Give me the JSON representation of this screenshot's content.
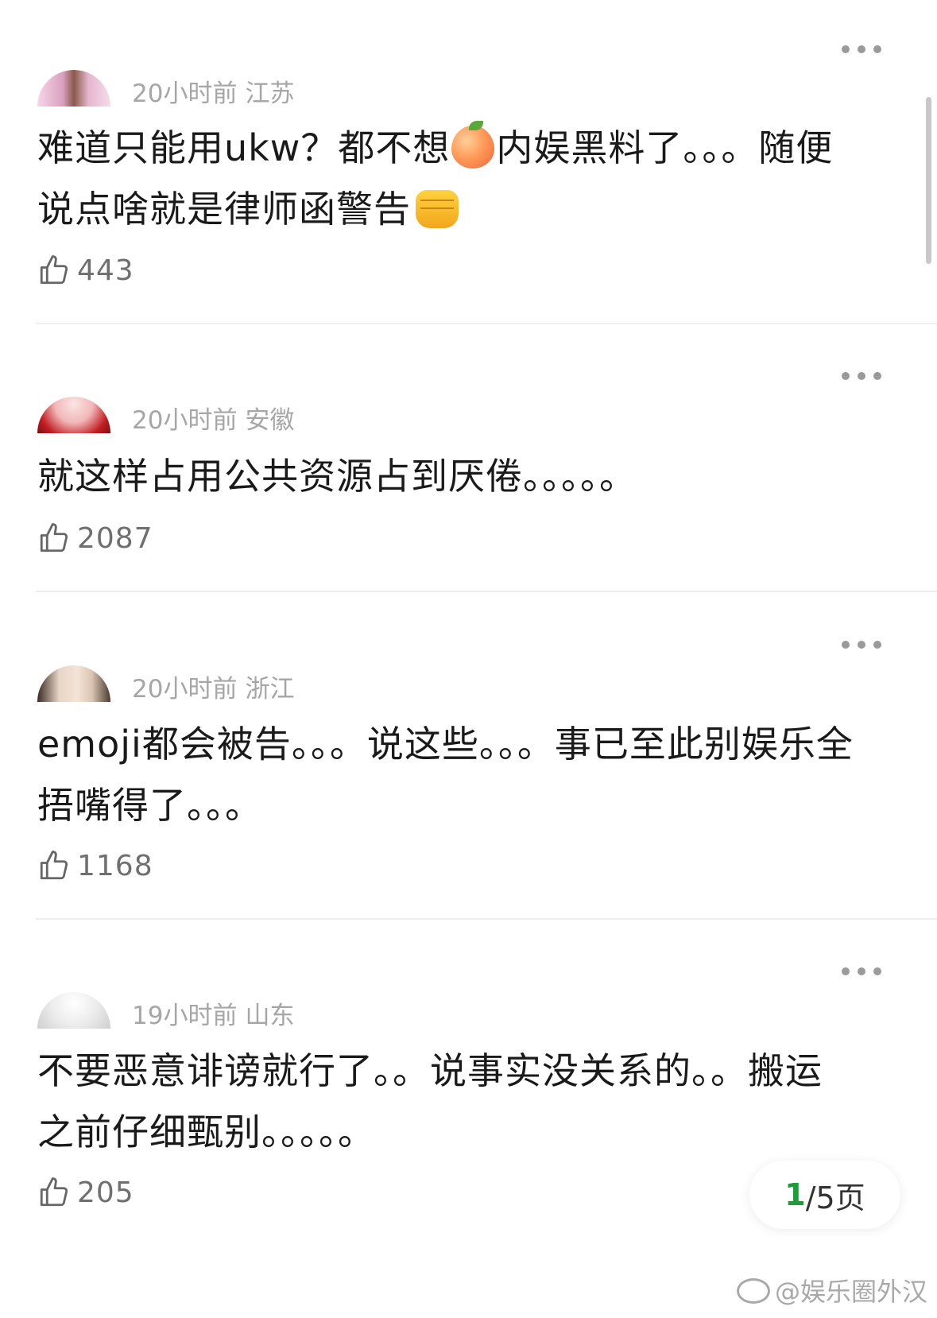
{
  "comments": [
    {
      "time": "20小时前",
      "location": "江苏",
      "text_a": "难道只能用ukw？都不想",
      "emoji_peach": "peach-emoji",
      "text_b": "内娱黑料了。。。随便\n说点啥就是律师函警告",
      "emoji_fist": "oncoming-fist-emoji",
      "likes": "443"
    },
    {
      "time": "20小时前",
      "location": "安徽",
      "text": "就这样占用公共资源占到厌倦。。。。。",
      "likes": "2087"
    },
    {
      "time": "20小时前",
      "location": "浙江",
      "text": "emoji都会被告。。。说这些。。。事已至此别娱乐全\n捂嘴得了。。。",
      "likes": "1168"
    },
    {
      "time": "19小时前",
      "location": "山东",
      "text": "不要恶意诽谤就行了。。说事实没关系的。。搬运\n之前仔细甄别。。。。。",
      "likes": "205"
    }
  ],
  "pager": {
    "current": "1",
    "rest": "/5页"
  },
  "watermark": {
    "text": "@娱乐圈外汉"
  },
  "icons": {
    "more": "more-dots-icon",
    "like": "thumbs-up-icon",
    "watermark_logo": "weibo-logo"
  },
  "colors": {
    "accent": "#1f9c3a",
    "meta": "#a6a6a6",
    "text": "#1a1a1a"
  }
}
